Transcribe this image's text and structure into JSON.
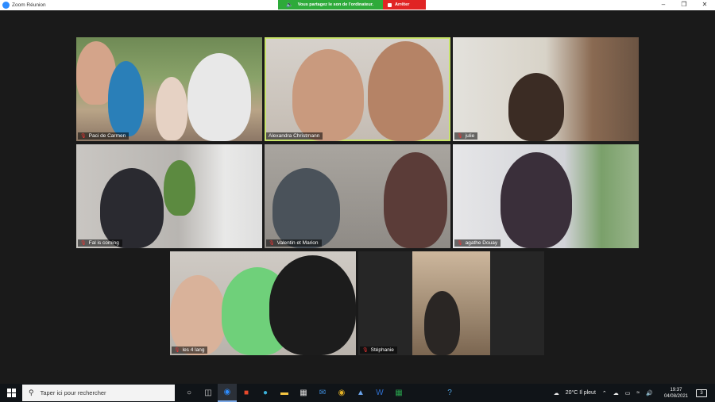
{
  "window": {
    "title": "Zoom Réunion",
    "share_message": "Vous partagez le son de l'ordinateur.",
    "stop_label": "Arrêter"
  },
  "participants": [
    {
      "name": "Paci de Carmen"
    },
    {
      "name": "Alexandra Christmann"
    },
    {
      "name": "julie"
    },
    {
      "name": "Fal is coming"
    },
    {
      "name": "Valentin et Marion"
    },
    {
      "name": "agathe Douay"
    },
    {
      "name": "les 4 lang"
    },
    {
      "name": "Stéphanie"
    }
  ],
  "taskbar": {
    "search_placeholder": "Taper ici pour rechercher",
    "weather": "20°C  Il pleut",
    "time": "19:37",
    "date": "04/08/2021",
    "notifications": "3"
  },
  "colors": {
    "share_green": "#2eaa3a",
    "stop_red": "#e02424",
    "active_speaker": "#c8e36a"
  }
}
